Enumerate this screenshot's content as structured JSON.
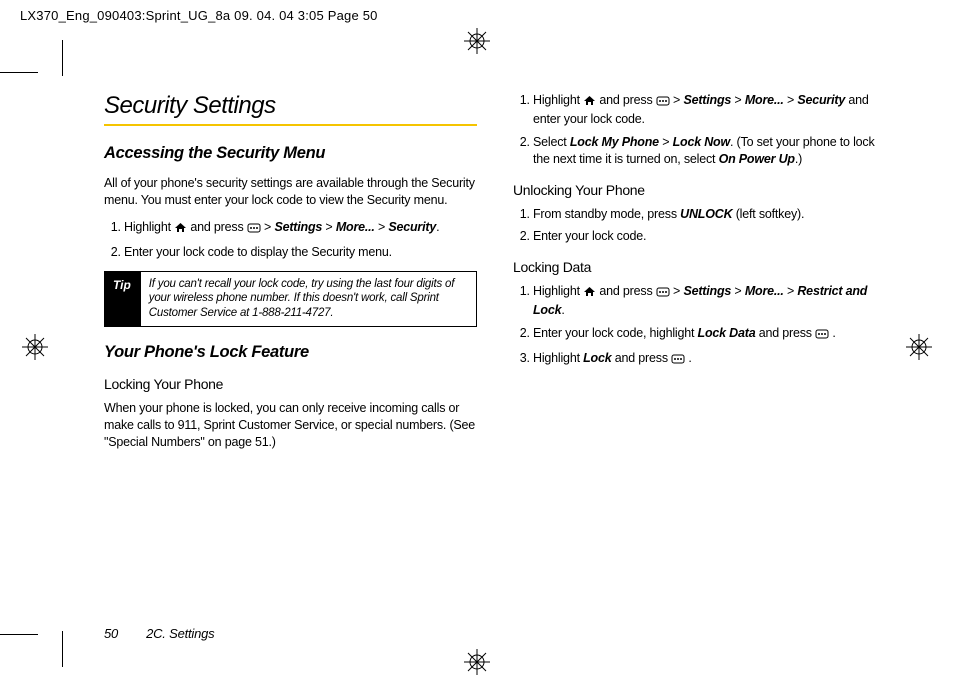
{
  "print_header": "LX370_Eng_090403:Sprint_UG_8a  09. 04. 04    3:05  Page 50",
  "left": {
    "title": "Security Settings",
    "h2_access": "Accessing the Security Menu",
    "p_access": "All of your phone's security settings are available through the Security menu. You must enter your lock code to view the Security menu.",
    "step1_a": "Highlight ",
    "step1_b": " and press ",
    "step1_c": " > ",
    "step1_path1": "Settings",
    "step1_path2": "More...",
    "step1_path3": "Security",
    "step1_d": ".",
    "step2": "Enter your lock code to display the Security menu.",
    "tip_label": "Tip",
    "tip_text": "If you can't recall your lock code, try using the last four digits of your wireless phone number. If this doesn't work, call Sprint Customer Service at 1-888-211-4727.",
    "h2_lock": "Your Phone's Lock Feature",
    "h3_locking": "Locking Your Phone",
    "p_locking": "When your phone is locked, you can only receive incoming calls or make calls to 911, Sprint Customer Service, or special numbers. (See \"Special Numbers\" on page 51.)"
  },
  "right": {
    "r1_a": "Highlight ",
    "r1_b": " and press ",
    "r1_c": " > ",
    "r1_p1": "Settings",
    "r1_p2": "More...",
    "r1_p3": "Security",
    "r1_d": " and enter your lock code.",
    "r2_a": "Select ",
    "r2_p1": "Lock My Phone",
    "r2_p2": "Lock Now",
    "r2_b": ". (To set your phone to lock the next time it is turned on, select ",
    "r2_p3": "On Power Up",
    "r2_c": ".)",
    "h3_unlock": "Unlocking Your Phone",
    "u1_a": "From standby mode, press ",
    "u1_b": "UNLOCK",
    "u1_c": " (left softkey).",
    "u2": "Enter your lock code.",
    "h3_lockdata": "Locking Data",
    "d1_a": "Highlight ",
    "d1_b": " and press ",
    "d1_c": " > ",
    "d1_p1": "Settings",
    "d1_p2": "More...",
    "d1_p3": "Restrict and Lock",
    "d1_d": ".",
    "d2_a": "Enter your lock code, highlight ",
    "d2_b": "Lock Data",
    "d2_c": " and press ",
    "d2_d": " .",
    "d3_a": "Highlight ",
    "d3_b": "Lock",
    "d3_c": " and press ",
    "d3_d": " ."
  },
  "footer_num": "50",
  "footer_text": "2C. Settings"
}
